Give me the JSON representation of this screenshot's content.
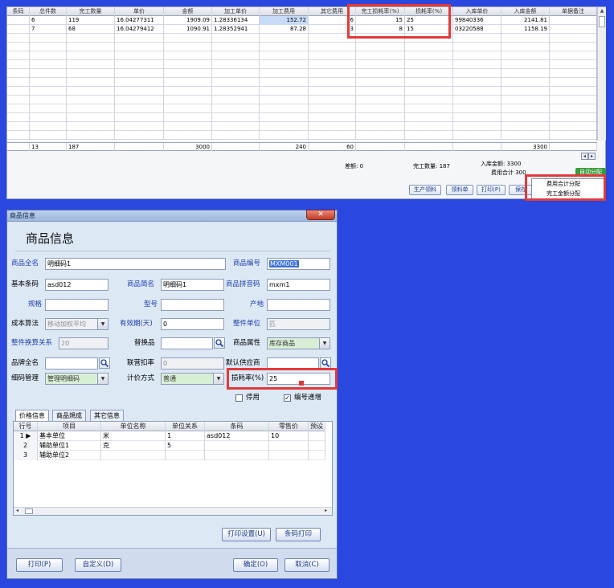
{
  "grid": {
    "columns": [
      "条码",
      "总件数",
      "完工数量",
      "单价",
      "金额",
      "加工单价",
      "加工费用",
      "其它费用",
      "完工损耗率(%)",
      "损耗率(%)",
      "入库单价",
      "入库金额",
      "单据备注"
    ],
    "rows": [
      [
        "",
        "6",
        "119",
        "16.04277311",
        "1909.09",
        "1.28336134",
        "152.72",
        "6",
        "15",
        "25",
        "99840336",
        "2141.81",
        ""
      ],
      [
        "",
        "7",
        "68",
        "16.04279412",
        "1090.91",
        "1.28352941",
        "87.28",
        "-3",
        "8",
        "15",
        "03220588",
        "1158.19",
        ""
      ]
    ],
    "summary": [
      "",
      "13",
      "187",
      "",
      "3000",
      "",
      "240",
      "60",
      "",
      "",
      "",
      "3300",
      ""
    ]
  },
  "stats": {
    "diff": "差额: 0",
    "done_qty": "完工数量: 187",
    "in_amount": "入库金额: 3300",
    "fee_total": "费用合计 300"
  },
  "toolbar": {
    "production_bill": "生产领料",
    "material_bill": "领料单",
    "print": "打印(P)",
    "save": "保存",
    "apply": "自动分配"
  },
  "menu": {
    "item1": "费用合计分配",
    "item2": "完工金额分配"
  },
  "dialog": {
    "window_title": "商品信息",
    "heading": "商品信息",
    "close_label": "✕",
    "labels": {
      "full_name": "商品全名",
      "code": "商品编号",
      "barcode": "基本条码",
      "short_name": "商品简名",
      "pinyin": "商品拼音码",
      "spec": "规格",
      "model": "型号",
      "origin": "产地",
      "cost_method": "成本算法",
      "shelf_life": "有效期(天)",
      "unit": "整件单位",
      "conv": "整件换算关系",
      "substitute": "替换品",
      "attr": "商品属性",
      "brand": "品牌全名",
      "discount": "联营扣率",
      "supplier": "默认供应商",
      "detail_mgmt": "细码管理",
      "price_method": "计价方式",
      "loss_rate": "损耗率(%)",
      "disabled": "停用",
      "auto_inc": "编号递增"
    },
    "values": {
      "full_name": "明细码1",
      "code": "MXM001",
      "barcode": "asd012",
      "short_name": "明细码1",
      "pinyin": "mxm1",
      "spec": "",
      "model": "",
      "origin": "",
      "cost_method": "移动加权平均",
      "shelf_life": "0",
      "unit": "匹",
      "conv": "20",
      "substitute": "",
      "attr": "库存商品",
      "brand": "",
      "discount": "0",
      "supplier": "",
      "detail_mgmt": "管理明细码",
      "price_method": "普通",
      "loss_rate": "25"
    },
    "tabs": [
      "价格信息",
      "商品規成",
      "其它信息"
    ],
    "table": {
      "headers": [
        "行号",
        "项目",
        "单位名称",
        "单位关系",
        "条码",
        "零售价",
        "预设"
      ],
      "rows": [
        [
          "1",
          "基本单位",
          "米",
          "1",
          "asd012",
          "10",
          ""
        ],
        [
          "2",
          "辅助单位1",
          "克",
          "5",
          "",
          "",
          ""
        ],
        [
          "3",
          "辅助单位2",
          "",
          "",
          "",
          "",
          ""
        ]
      ]
    },
    "buttons": {
      "print_setup": "打印设置(U)",
      "barcode_print": "条码打印",
      "print": "打印(P)",
      "customize": "自定义(D)",
      "ok": "确定(O)",
      "cancel": "取消(C)"
    }
  }
}
